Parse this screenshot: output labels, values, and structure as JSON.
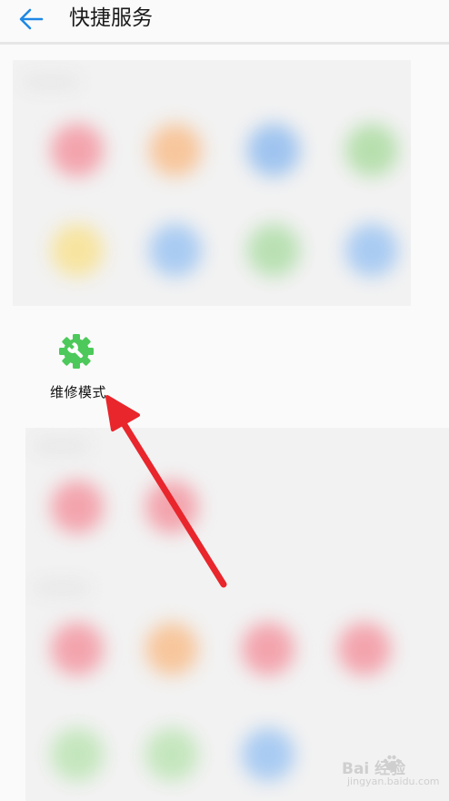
{
  "header": {
    "title": "快捷服务",
    "back_icon": "arrow-left-icon",
    "accent_color": "#1e88e5"
  },
  "service": {
    "label": "维修模式",
    "icon": "gear-wrench-icon",
    "icon_color": "#4cc95a"
  },
  "annotation": {
    "arrow_color": "#e8262c"
  },
  "watermark": {
    "main": "Bai 经验",
    "sub": "jingyan.baidu.com"
  }
}
